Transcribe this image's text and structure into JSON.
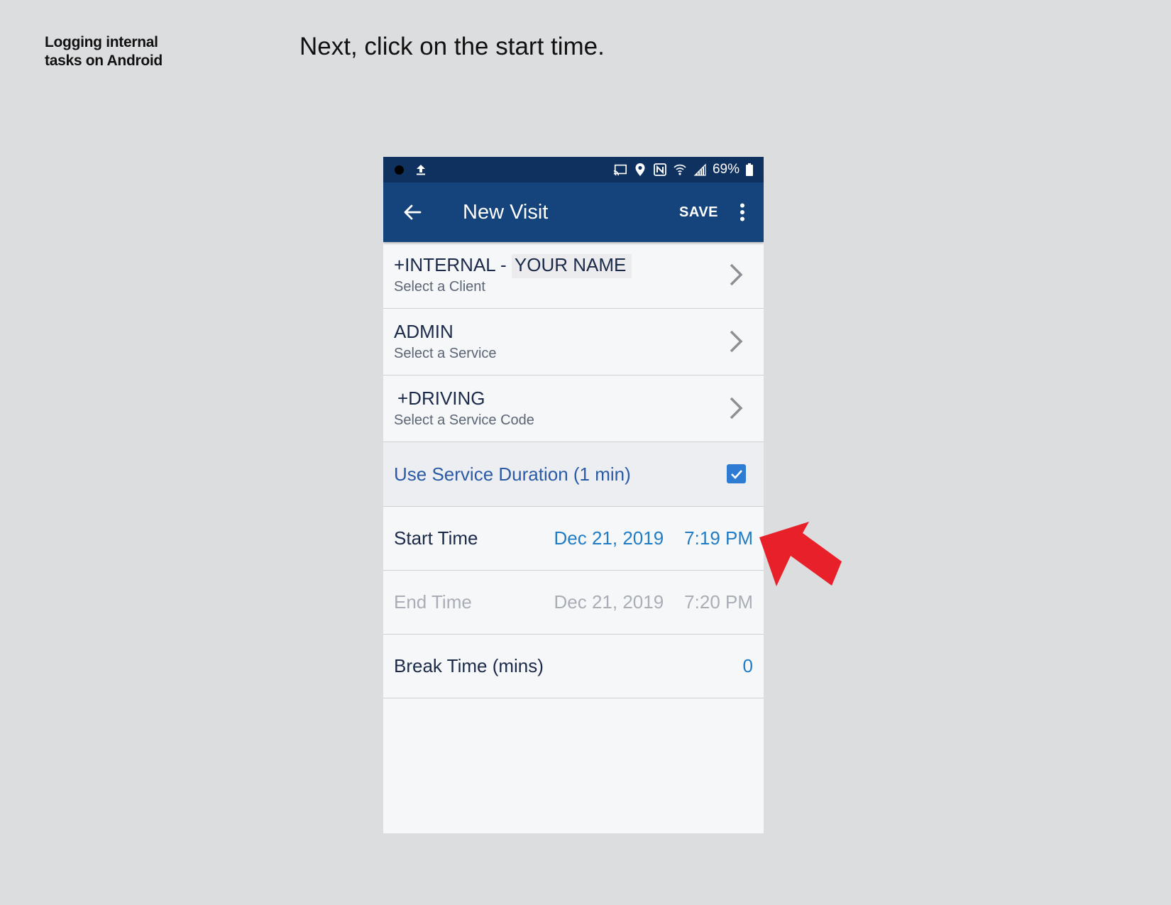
{
  "guide": {
    "title_line1": "Logging internal",
    "title_line2": "tasks on Android",
    "instruction": "Next, click on the start time."
  },
  "statusbar": {
    "battery": "69%",
    "icons": [
      "notification-dot-icon",
      "upload-icon",
      "cast-icon",
      "location-icon",
      "nfc-icon",
      "wifi-icon",
      "signal-icon",
      "battery-icon"
    ]
  },
  "appbar": {
    "title": "New Visit",
    "save_label": "SAVE",
    "icons": [
      "back-arrow-icon",
      "more-vert-icon"
    ]
  },
  "form": {
    "client": {
      "prefix": "+INTERNAL -",
      "name": "YOUR NAME",
      "sub": "Select a Client"
    },
    "service": {
      "value": "ADMIN",
      "sub": "Select a Service"
    },
    "service_code": {
      "value": "+DRIVING",
      "sub": "Select a Service Code"
    },
    "use_duration": {
      "label": "Use Service Duration (1 min)",
      "checked": true
    },
    "start_time": {
      "label": "Start Time",
      "date": "Dec 21, 2019",
      "time": "7:19 PM"
    },
    "end_time": {
      "label": "End Time",
      "date": "Dec 21, 2019",
      "time": "7:20 PM"
    },
    "break_time": {
      "label": "Break Time (mins)",
      "value": "0"
    }
  },
  "colors": {
    "statusbar": "#0f3160",
    "appbar": "#15437c",
    "link_blue": "#1f7cc5",
    "checkbox": "#2e7bd3",
    "pointer_arrow": "#e8202a"
  }
}
